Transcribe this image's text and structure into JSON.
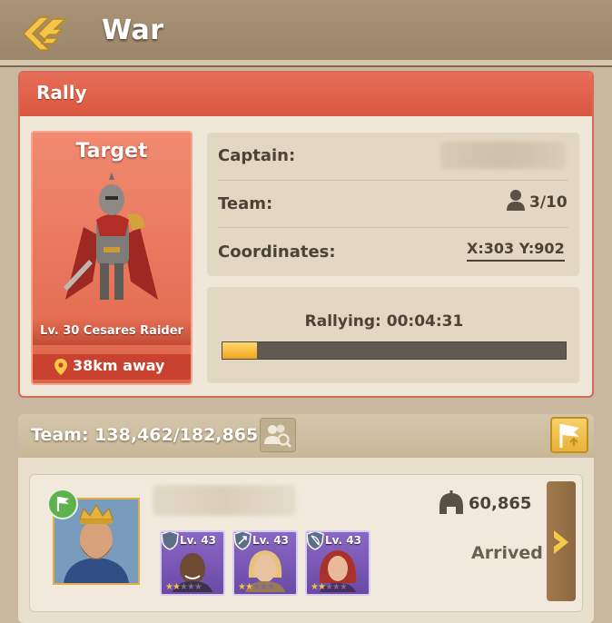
{
  "header": {
    "title": "War"
  },
  "rally": {
    "title": "Rally",
    "target": {
      "heading": "Target",
      "name": "Lv. 30 Cesares Raider",
      "distance": "38km away"
    },
    "info": {
      "captain_label": "Captain:",
      "team_label": "Team:",
      "team_count": "3/10",
      "coordinates_label": "Coordinates:",
      "coordinates": "X:303 Y:902"
    },
    "status": {
      "text": "Rallying: 00:04:31",
      "progress_fraction": 0.1
    }
  },
  "team": {
    "label": "Team: 138,462/182,865",
    "member": {
      "power": "60,865",
      "status": "Arrived",
      "heroes": [
        {
          "level": "Lv. 43",
          "role_icon": "shield-icon"
        },
        {
          "level": "Lv. 43",
          "role_icon": "arrow-icon"
        },
        {
          "level": "Lv. 43",
          "role_icon": "bow-icon"
        }
      ]
    }
  },
  "colors": {
    "accent_red": "#d9573f",
    "gold": "#e9b237",
    "progress": "#f0a51e"
  }
}
